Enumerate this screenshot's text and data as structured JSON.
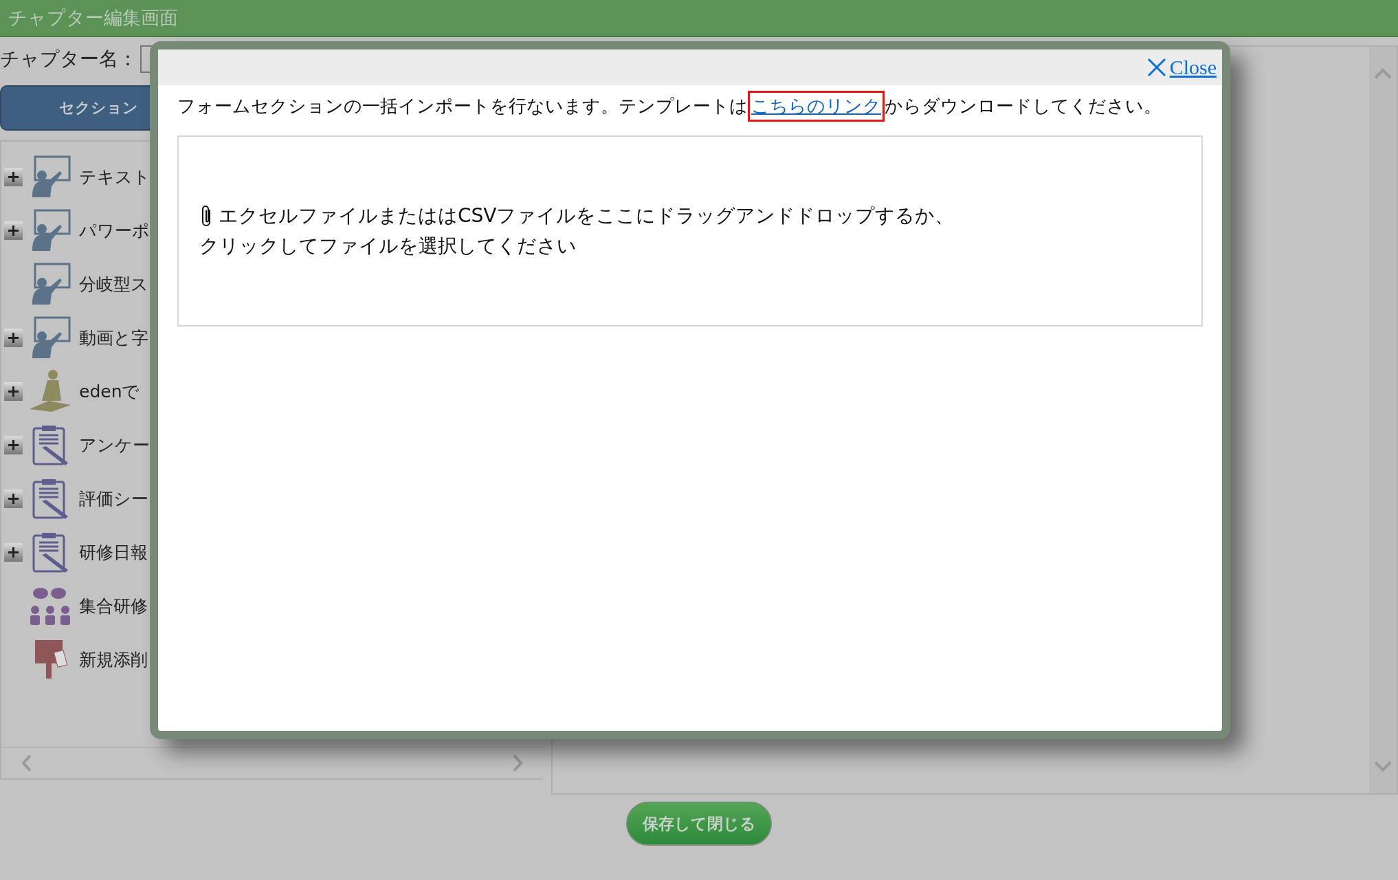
{
  "window": {
    "title": "チャプター編集画面"
  },
  "chapter_name": {
    "label": "チャプター名："
  },
  "section_button": {
    "label": "セクション"
  },
  "tree": {
    "items": [
      {
        "label": "テキスト",
        "kind": "lecture",
        "collapsible": true
      },
      {
        "label": "パワーポ",
        "kind": "lecture",
        "collapsible": true
      },
      {
        "label": "分岐型ス",
        "kind": "lecture",
        "collapsible": false
      },
      {
        "label": "動画と字",
        "kind": "lecture",
        "collapsible": true
      },
      {
        "label": "edenで",
        "kind": "eden",
        "collapsible": true
      },
      {
        "label": "アンケー",
        "kind": "form",
        "collapsible": true
      },
      {
        "label": "評価シー",
        "kind": "form",
        "collapsible": true
      },
      {
        "label": "研修日報",
        "kind": "form",
        "collapsible": true
      },
      {
        "label": "集合研修",
        "kind": "group",
        "collapsible": false
      },
      {
        "label": "新規添削",
        "kind": "post",
        "collapsible": false
      }
    ]
  },
  "save_button": {
    "label": "保存して閉じる"
  },
  "dialog": {
    "close": "Close",
    "instructions": {
      "before": "フォームセクションの一括インポートを行ないます。テンプレートは",
      "link": "こちらのリンク",
      "after": "からダウンロードしてください。",
      "link_highlighted": true
    },
    "drop_zone": {
      "lines": [
        "エクセルファイルまたははCSVファイルをここにドラッグアンドドロップするか、",
        "クリックしてファイルを選択してください"
      ]
    }
  }
}
